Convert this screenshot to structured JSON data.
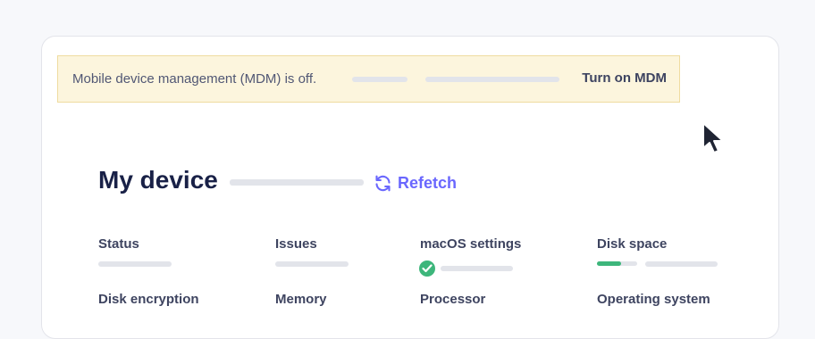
{
  "banner": {
    "message": "Mobile device management (MDM) is off.",
    "action_label": "Turn on MDM",
    "background": "#fcf5dd",
    "border": "#efdca0"
  },
  "device": {
    "title": "My device",
    "refetch_label": "Refetch",
    "accent": "#6a67fe"
  },
  "info_labels": {
    "status": "Status",
    "issues": "Issues",
    "macos_settings": "macOS settings",
    "disk_space": "Disk space",
    "disk_encryption": "Disk encryption",
    "memory": "Memory",
    "processor": "Processor",
    "operating_system": "Operating system"
  },
  "disk_space_usage": 0.6,
  "status_colors": {
    "success": "#3db67b"
  },
  "icons": {
    "refetch": "refresh-icon",
    "settings_status": "check-circle-icon",
    "pointer": "mouse-cursor-icon"
  }
}
